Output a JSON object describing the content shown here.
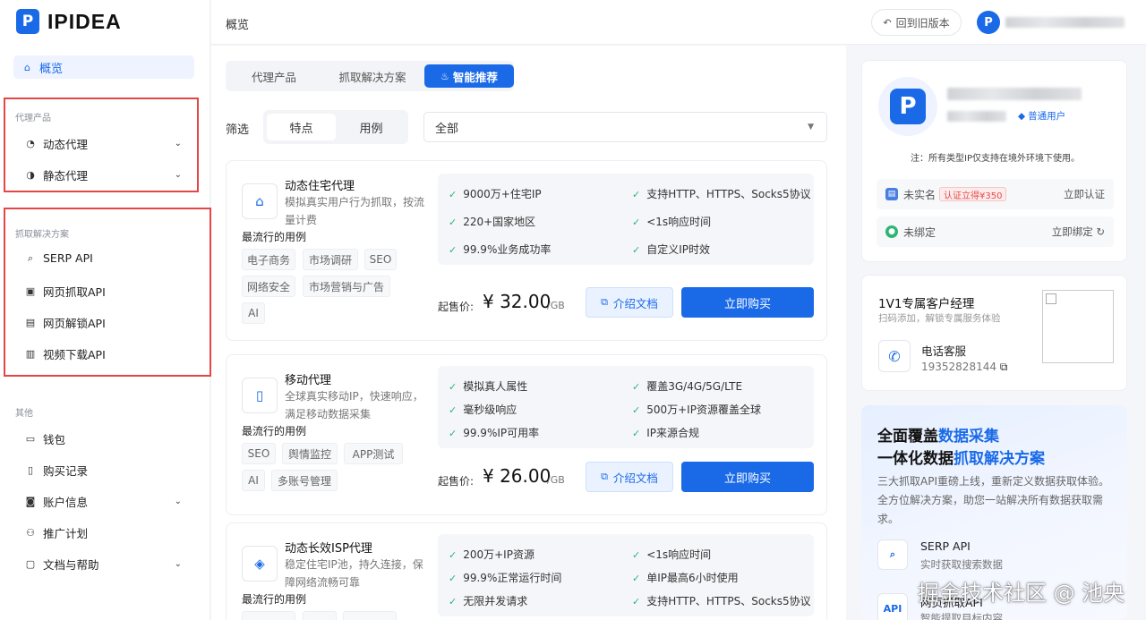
{
  "app": {
    "logo_mark": "P",
    "logo_text": "IPIDEA"
  },
  "sidebar": {
    "overview": "概览",
    "proxy_group": {
      "title": "代理产品",
      "items": [
        {
          "label": "动态代理"
        },
        {
          "label": "静态代理"
        }
      ]
    },
    "scrape_group": {
      "title": "抓取解决方案",
      "items": [
        {
          "label": "SERP API"
        },
        {
          "label": "网页抓取API"
        },
        {
          "label": "网页解锁API"
        },
        {
          "label": "视频下载API"
        }
      ]
    },
    "other_group": {
      "title": "其他",
      "items": [
        {
          "label": "钱包"
        },
        {
          "label": "购买记录"
        },
        {
          "label": "账户信息"
        },
        {
          "label": "推广计划"
        },
        {
          "label": "文档与帮助"
        }
      ]
    }
  },
  "header": {
    "title": "概览",
    "old_version": "回到旧版本",
    "avatar_mark": "P"
  },
  "main": {
    "tabs": [
      "代理产品",
      "抓取解决方案",
      "智能推荐"
    ],
    "filter_label": "筛选",
    "segments": [
      "特点",
      "用例"
    ],
    "select_value": "全部",
    "popular_label": "最流行的用例",
    "price_label": "起售价:",
    "doc_label": "介绍文档",
    "buy_label": "立即购买",
    "products": [
      {
        "name": "动态住宅代理",
        "desc": "模拟真实用户行为抓取，按流量计费",
        "tags": [
          "电子商务",
          "市场调研",
          "SEO",
          "网络安全",
          "市场营销与广告",
          "AI"
        ],
        "features": [
          "9000万+住宅IP",
          "支持HTTP、HTTPS、Socks5协议",
          "220+国家地区",
          "<1s响应时间",
          "99.9%业务成功率",
          "自定义IP时效"
        ],
        "price": "¥ 32.00",
        "unit": "/GB"
      },
      {
        "name": "移动代理",
        "desc": "全球真实移动IP，快速响应，满足移动数据采集",
        "tags": [
          "SEO",
          "舆情监控",
          "APP测试",
          "AI",
          "多账号管理"
        ],
        "features": [
          "模拟真人属性",
          "覆盖3G/4G/5G/LTE",
          "毫秒级响应",
          "500万+IP资源覆盖全球",
          "99.9%IP可用率",
          "IP来源合规"
        ],
        "price": "¥ 26.00",
        "unit": "/GB"
      },
      {
        "name": "动态长效ISP代理",
        "desc": "稳定住宅IP池，持久连接，保障网络流畅可靠",
        "tags": [],
        "features": [
          "200万+IP资源",
          "<1s响应时间",
          "99.9%正常运行时间",
          "单IP最高6小时使用",
          "无限并发请求",
          "支持HTTP、HTTPS、Socks5协议"
        ],
        "price": "",
        "unit": ""
      }
    ]
  },
  "right": {
    "user_type": "普通用户",
    "note": "注：所有类型IP仅支持在境外环境下使用。",
    "realname": {
      "label": "未实名",
      "tag": "认证立得¥350",
      "action": "立即认证"
    },
    "wechat": {
      "label": "未绑定",
      "action": "立即绑定"
    },
    "manager": {
      "title": "1V1专属客户经理",
      "subtitle": "扫码添加，解锁专属服务体验",
      "phone_label": "电话客服",
      "phone": "19352828144"
    },
    "promo": {
      "line1_a": "全面覆盖",
      "line1_b": "数据采集",
      "line2_a": "一体化数据",
      "line2_b": "抓取解决方案",
      "desc": "三大抓取API重磅上线，重新定义数据获取体验。全方位解决方案，助您一站解决所有数据获取需求。",
      "items": [
        {
          "title": "SERP API",
          "sub": "实时获取搜索数据",
          "icon": "API"
        },
        {
          "title": "网页抓取API",
          "sub": "智能提取目标内容",
          "icon": "API"
        }
      ]
    }
  },
  "watermark": "掘金技术社区 @ 池央",
  "colors": {
    "accent": "#1a6ae8",
    "check": "#2bb673",
    "highlight_box": "#e64545"
  }
}
